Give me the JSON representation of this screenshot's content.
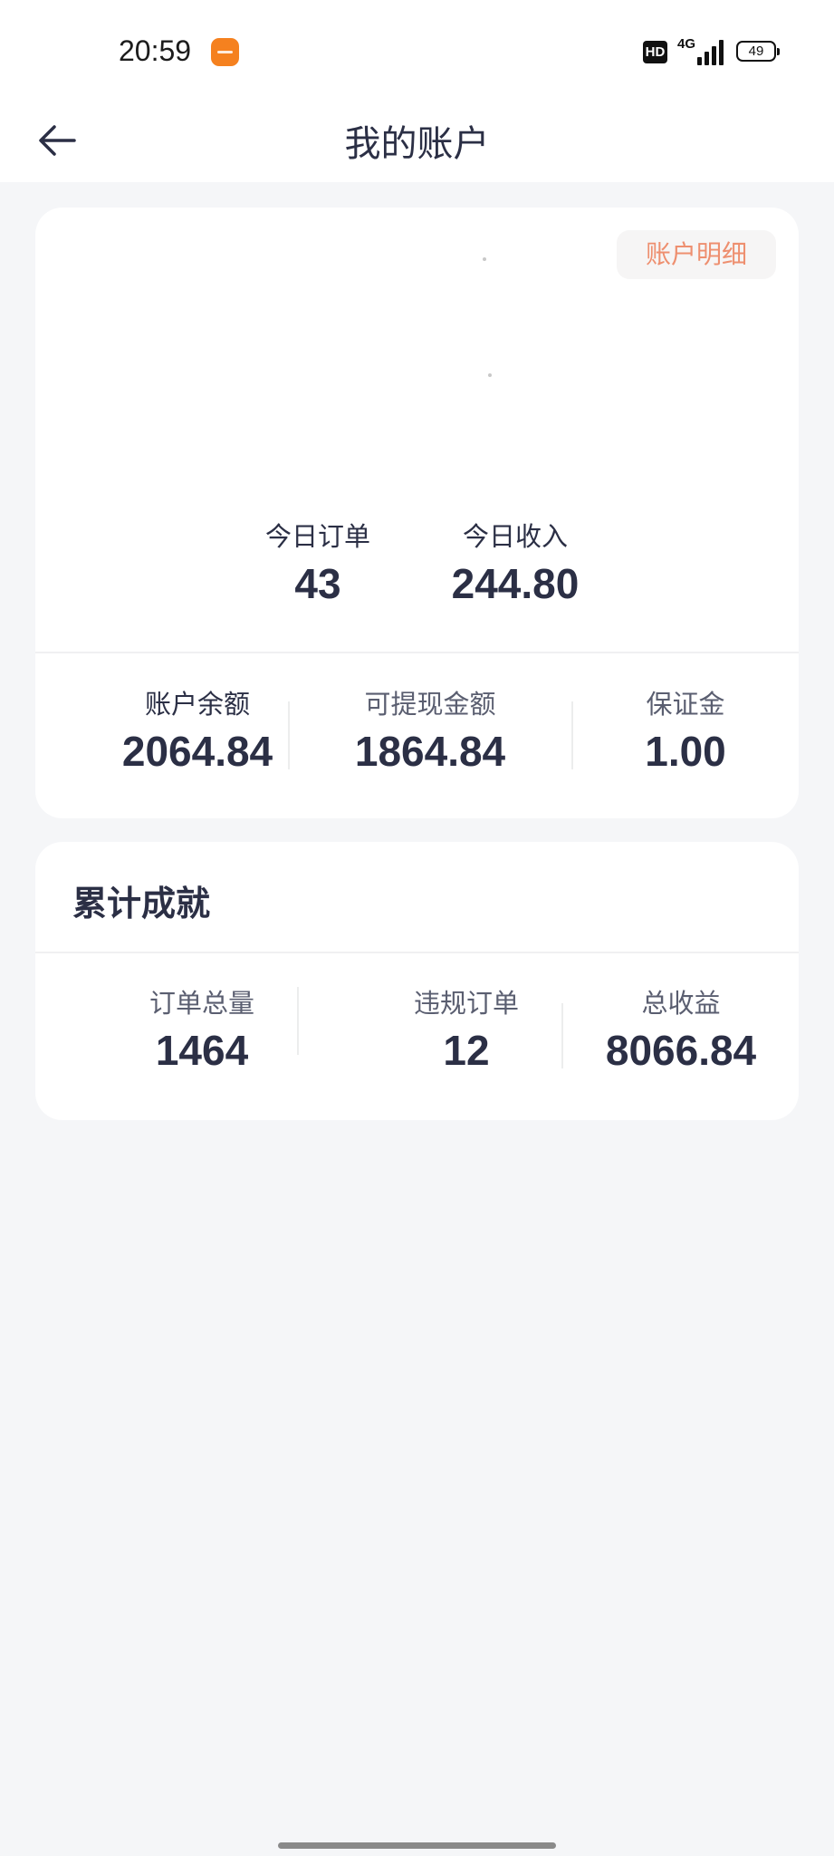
{
  "status_bar": {
    "time": "20:59",
    "network": "4G",
    "hd": "HD",
    "battery": "49"
  },
  "nav": {
    "title": "我的账户"
  },
  "account": {
    "detail_button": "账户明细",
    "today": [
      {
        "label": "今日订单",
        "value": "43"
      },
      {
        "label": "今日收入",
        "value": "244.80"
      }
    ],
    "balances": [
      {
        "label": "账户余额",
        "value": "2064.84"
      },
      {
        "label": "可提现金额",
        "value": "1864.84"
      },
      {
        "label": "保证金",
        "value": "1.00"
      }
    ]
  },
  "achievements": {
    "title": "累计成就",
    "stats": [
      {
        "label": "订单总量",
        "value": "1464"
      },
      {
        "label": "违规订单",
        "value": "12"
      },
      {
        "label": "总收益",
        "value": "8066.84"
      }
    ]
  },
  "colors": {
    "accent": "#ee8f6f",
    "text_primary": "#2b2f45",
    "background": "#f5f6f8",
    "card": "#ffffff"
  }
}
